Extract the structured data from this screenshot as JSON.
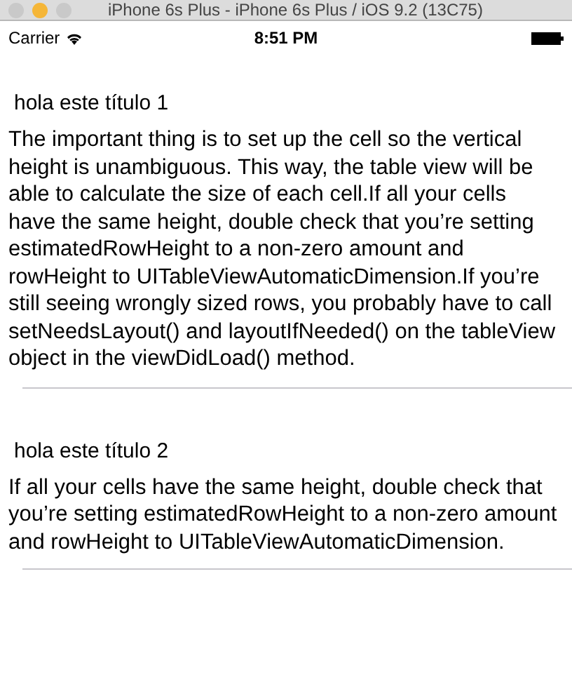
{
  "window": {
    "title": "iPhone 6s Plus - iPhone 6s Plus / iOS 9.2 (13C75)"
  },
  "status_bar": {
    "carrier": "Carrier",
    "time": "8:51 PM"
  },
  "cells": [
    {
      "title": "hola este título 1",
      "body": "The important thing is to set up the cell so the vertical height is unambiguous. This way, the table view will be able to calculate the size of each cell.If all your cells have the same height, double check that you’re setting estimatedRowHeight to a non-zero amount and rowHeight  to UITableViewAutomaticDimension.If you’re still seeing wrongly sized rows, you probably have to call setNeedsLayout() and layoutIfNeeded() on the tableView object in the viewDidLoad() method."
    },
    {
      "title": "hola este título 2",
      "body": "If all your cells have the same height, double check that you’re setting estimatedRowHeight to a non-zero amount and rowHeight  to UITableViewAutomaticDimension."
    }
  ]
}
